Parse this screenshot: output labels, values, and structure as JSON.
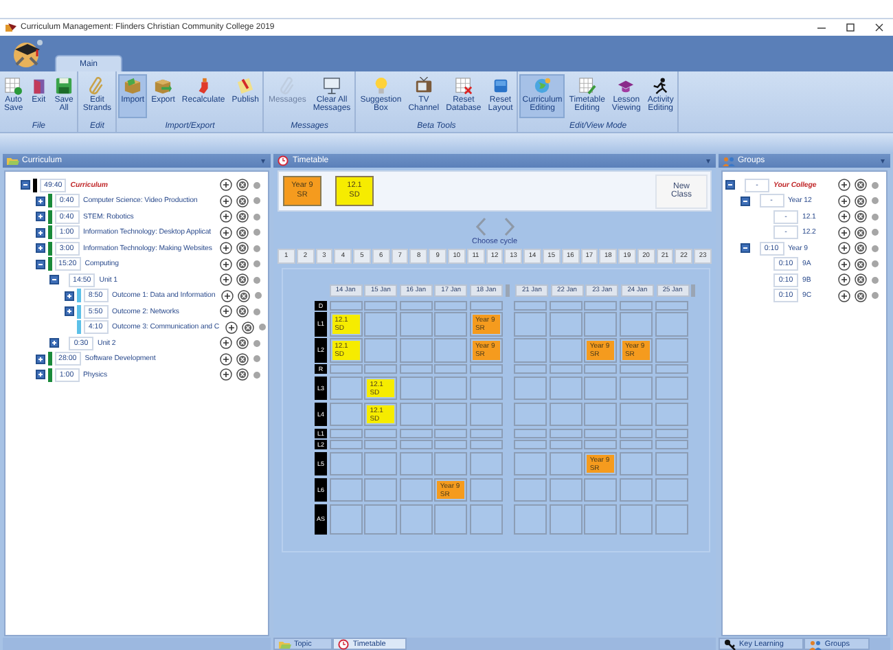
{
  "window": {
    "title": "Curriculum Management: Flinders Christian Community College 2019"
  },
  "ribbon": {
    "tabs": [
      {
        "label": "Main",
        "selected": true
      }
    ],
    "groups": [
      {
        "label": "File",
        "buttons": [
          {
            "label": "Auto\nSave",
            "selected": false,
            "disabled": false
          },
          {
            "label": "Exit",
            "selected": false,
            "disabled": false
          },
          {
            "label": "Save\nAll",
            "selected": false,
            "disabled": false
          }
        ]
      },
      {
        "label": "Edit",
        "buttons": [
          {
            "label": "Edit\nStrands",
            "selected": false,
            "disabled": false
          }
        ]
      },
      {
        "label": "Import/Export",
        "buttons": [
          {
            "label": "Import",
            "selected": true,
            "disabled": false
          },
          {
            "label": "Export",
            "selected": false,
            "disabled": false
          },
          {
            "label": "Recalculate",
            "selected": false,
            "disabled": false
          },
          {
            "label": "Publish",
            "selected": false,
            "disabled": false
          }
        ]
      },
      {
        "label": "Messages",
        "buttons": [
          {
            "label": "Messages",
            "selected": false,
            "disabled": true
          },
          {
            "label": "Clear All\nMessages",
            "selected": false,
            "disabled": false
          }
        ]
      },
      {
        "label": "Beta Tools",
        "buttons": [
          {
            "label": "Suggestion\nBox",
            "selected": false,
            "disabled": false
          },
          {
            "label": "TV\nChannel",
            "selected": false,
            "disabled": false
          },
          {
            "label": "Reset\nDatabase",
            "selected": false,
            "disabled": false
          },
          {
            "label": "Reset\nLayout",
            "selected": false,
            "disabled": false
          }
        ]
      },
      {
        "label": "Edit/View Mode",
        "buttons": [
          {
            "label": "Curriculum\nEditing",
            "selected": true,
            "disabled": false
          },
          {
            "label": "Timetable\nEditing",
            "selected": false,
            "disabled": false
          },
          {
            "label": "Lesson\nViewing",
            "selected": false,
            "disabled": false
          },
          {
            "label": "Activity\nEditing",
            "selected": false,
            "disabled": false
          }
        ]
      }
    ]
  },
  "curriculum_panel": {
    "title": "Curriculum",
    "tree": [
      {
        "time": "49:40",
        "label": "Curriculum",
        "color": "#000000",
        "expanded": true,
        "children": [
          {
            "time": "0:40",
            "label": "Computer Science: Video Production",
            "color": "#1a8a3a",
            "expanded": false
          },
          {
            "time": "0:40",
            "label": "STEM: Robotics",
            "color": "#1a8a3a",
            "expanded": false
          },
          {
            "time": "1:00",
            "label": "Information Technology: Desktop Applicat",
            "color": "#1a8a3a",
            "expanded": false
          },
          {
            "time": "3:00",
            "label": "Information Technology: Making Websites",
            "color": "#1a8a3a",
            "expanded": false
          },
          {
            "time": "15:20",
            "label": "Computing",
            "color": "#1a8a3a",
            "expanded": true,
            "children": [
              {
                "time": "14:50",
                "label": "Unit 1",
                "expanded": true,
                "children": [
                  {
                    "time": "8:50",
                    "label": "Outcome 1: Data and Information",
                    "color": "#5cc0e8",
                    "expanded": false
                  },
                  {
                    "time": "5:50",
                    "label": "Outcome 2: Networks",
                    "color": "#5cc0e8",
                    "expanded": false
                  },
                  {
                    "time": "4:10",
                    "label": "Outcome 3: Communication and C",
                    "color": "#5cc0e8"
                  }
                ]
              },
              {
                "time": "0:30",
                "label": "Unit 2",
                "expanded": false
              }
            ]
          },
          {
            "time": "28:00",
            "label": "Software Development",
            "color": "#1a8a3a",
            "expanded": false
          },
          {
            "time": "1:00",
            "label": "Physics",
            "color": "#1a8a3a",
            "expanded": false
          }
        ]
      }
    ]
  },
  "timetable_panel": {
    "title": "Timetable",
    "classes": [
      {
        "line1": "Year 9",
        "line2": "SR",
        "color": "#f59b1e"
      },
      {
        "line1": "12.1",
        "line2": "SD",
        "color": "#f6ec00"
      }
    ],
    "new_class_button": "New Class",
    "cycle_label": "Choose cycle",
    "cycles": [
      "1",
      "2",
      "3",
      "4",
      "5",
      "6",
      "7",
      "8",
      "9",
      "10",
      "11",
      "12",
      "13",
      "14",
      "15",
      "16",
      "17",
      "18",
      "19",
      "20",
      "21",
      "22",
      "23"
    ],
    "weeks": [
      {
        "days": [
          "14 Jan",
          "15 Jan",
          "16 Jan",
          "17 Jan",
          "18 Jan"
        ]
      },
      {
        "days": [
          "21 Jan",
          "22 Jan",
          "23 Jan",
          "24 Jan",
          "25 Jan"
        ]
      }
    ],
    "rows": [
      {
        "label": "D",
        "kind": "break",
        "cells": [
          {
            "kind": "free"
          },
          {
            "kind": "free"
          },
          {
            "kind": "free"
          },
          {
            "kind": "free"
          },
          {
            "kind": "free"
          },
          {
            "kind": "free"
          },
          {
            "kind": "free"
          },
          {
            "kind": "free"
          },
          {
            "kind": "free"
          },
          {
            "kind": "free"
          }
        ]
      },
      {
        "label": "L1",
        "kind": "lesson",
        "cells": [
          {
            "kind": "class",
            "line1": "12.1",
            "line2": "SD",
            "color": "#f6ec00"
          },
          {
            "kind": "free"
          },
          {
            "kind": "free"
          },
          {
            "kind": "free"
          },
          {
            "kind": "class",
            "line1": "Year 9",
            "line2": "SR",
            "color": "#f59b1e"
          },
          {
            "kind": "free"
          },
          {
            "kind": "free"
          },
          {
            "kind": "free"
          },
          {
            "kind": "free"
          },
          {
            "kind": "free"
          }
        ]
      },
      {
        "label": "L2",
        "kind": "lesson",
        "cells": [
          {
            "kind": "class",
            "line1": "12.1",
            "line2": "SD",
            "color": "#f6ec00"
          },
          {
            "kind": "free"
          },
          {
            "kind": "free"
          },
          {
            "kind": "free"
          },
          {
            "kind": "class",
            "line1": "Year 9",
            "line2": "SR",
            "color": "#f59b1e"
          },
          {
            "kind": "free"
          },
          {
            "kind": "free"
          },
          {
            "kind": "class",
            "line1": "Year 9",
            "line2": "SR",
            "color": "#f59b1e"
          },
          {
            "kind": "class",
            "line1": "Year 9",
            "line2": "SR",
            "color": "#f59b1e"
          },
          {
            "kind": "free"
          }
        ]
      },
      {
        "label": "R",
        "kind": "break",
        "cells": [
          {
            "kind": "free"
          },
          {
            "kind": "free"
          },
          {
            "kind": "free"
          },
          {
            "kind": "free"
          },
          {
            "kind": "free"
          },
          {
            "kind": "free"
          },
          {
            "kind": "free"
          },
          {
            "kind": "free"
          },
          {
            "kind": "free"
          },
          {
            "kind": "free"
          }
        ]
      },
      {
        "label": "L3",
        "kind": "lesson",
        "cells": [
          {
            "kind": "free"
          },
          {
            "kind": "class",
            "line1": "12.1",
            "line2": "SD",
            "color": "#f6ec00"
          },
          {
            "kind": "free"
          },
          {
            "kind": "free"
          },
          {
            "kind": "free"
          },
          {
            "kind": "free"
          },
          {
            "kind": "free"
          },
          {
            "kind": "free"
          },
          {
            "kind": "free"
          },
          {
            "kind": "free"
          }
        ]
      },
      {
        "label": "L4",
        "kind": "lesson",
        "cells": [
          {
            "kind": "free"
          },
          {
            "kind": "class",
            "line1": "12.1",
            "line2": "SD",
            "color": "#f6ec00"
          },
          {
            "kind": "free"
          },
          {
            "kind": "free"
          },
          {
            "kind": "free"
          },
          {
            "kind": "free"
          },
          {
            "kind": "free"
          },
          {
            "kind": "free"
          },
          {
            "kind": "free"
          },
          {
            "kind": "free"
          }
        ]
      },
      {
        "label": "L1",
        "kind": "break",
        "cells": [
          {
            "kind": "free"
          },
          {
            "kind": "free"
          },
          {
            "kind": "free"
          },
          {
            "kind": "free"
          },
          {
            "kind": "free"
          },
          {
            "kind": "free"
          },
          {
            "kind": "free"
          },
          {
            "kind": "free"
          },
          {
            "kind": "free"
          },
          {
            "kind": "free"
          }
        ]
      },
      {
        "label": "L2",
        "kind": "break",
        "cells": [
          {
            "kind": "free"
          },
          {
            "kind": "free"
          },
          {
            "kind": "free"
          },
          {
            "kind": "free"
          },
          {
            "kind": "free"
          },
          {
            "kind": "free"
          },
          {
            "kind": "free"
          },
          {
            "kind": "free"
          },
          {
            "kind": "free"
          },
          {
            "kind": "free"
          }
        ]
      },
      {
        "label": "L5",
        "kind": "lesson",
        "cells": [
          {
            "kind": "free"
          },
          {
            "kind": "free"
          },
          {
            "kind": "free"
          },
          {
            "kind": "free"
          },
          {
            "kind": "free"
          },
          {
            "kind": "free"
          },
          {
            "kind": "free"
          },
          {
            "kind": "class",
            "line1": "Year 9",
            "line2": "SR",
            "color": "#f59b1e"
          },
          {
            "kind": "free"
          },
          {
            "kind": "free"
          }
        ]
      },
      {
        "label": "L6",
        "kind": "lesson",
        "cells": [
          {
            "kind": "free"
          },
          {
            "kind": "free"
          },
          {
            "kind": "free"
          },
          {
            "kind": "class",
            "line1": "Year 9",
            "line2": "SR",
            "color": "#f59b1e"
          },
          {
            "kind": "free"
          },
          {
            "kind": "free"
          },
          {
            "kind": "free"
          },
          {
            "kind": "free"
          },
          {
            "kind": "free"
          },
          {
            "kind": "free"
          }
        ]
      },
      {
        "label": "AS",
        "kind": "after",
        "cells": [
          {
            "kind": "free"
          },
          {
            "kind": "free"
          },
          {
            "kind": "free"
          },
          {
            "kind": "free"
          },
          {
            "kind": "free"
          },
          {
            "kind": "free"
          },
          {
            "kind": "free"
          },
          {
            "kind": "free"
          },
          {
            "kind": "free"
          },
          {
            "kind": "free"
          }
        ]
      }
    ],
    "tabs": [
      {
        "label": "Topic",
        "selected": false
      },
      {
        "label": "Timetable",
        "selected": true
      }
    ]
  },
  "groups_panel": {
    "title": "Groups",
    "tree": [
      {
        "time": "-",
        "label": "Your College",
        "expanded": true,
        "children": [
          {
            "time": "-",
            "label": "Year 12",
            "expanded": true,
            "children": [
              {
                "time": "-",
                "label": "12.1"
              },
              {
                "time": "-",
                "label": "12.2"
              }
            ]
          },
          {
            "time": "0:10",
            "label": "Year 9",
            "expanded": true,
            "children": [
              {
                "time": "0:10",
                "label": "9A"
              },
              {
                "time": "0:10",
                "label": "9B"
              },
              {
                "time": "0:10",
                "label": "9C"
              }
            ]
          }
        ]
      }
    ],
    "tabs": [
      {
        "label": "Key Learning",
        "selected": false
      },
      {
        "label": "Groups",
        "selected": false
      }
    ]
  }
}
